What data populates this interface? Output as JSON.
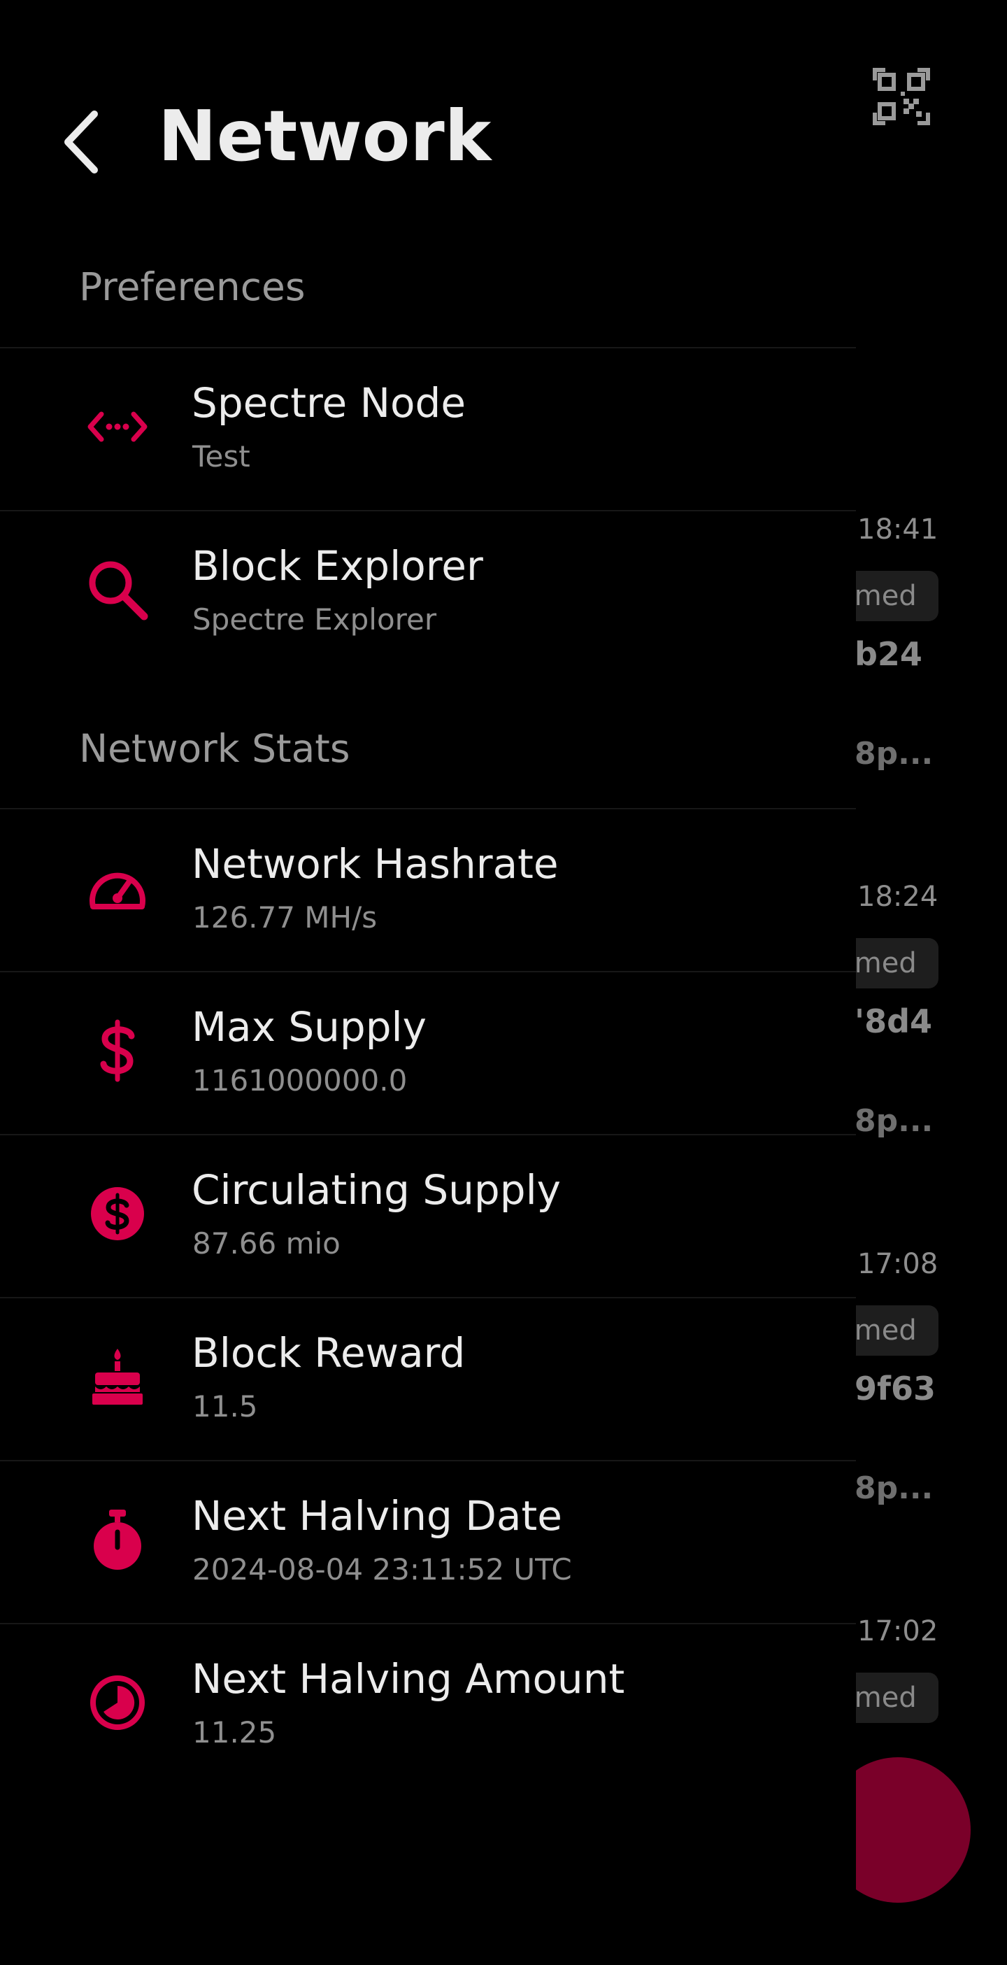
{
  "header": {
    "title": "Network",
    "back_icon": "chevron-left-icon",
    "qr_icon": "qr-code-icon"
  },
  "sections": [
    {
      "title": "Preferences",
      "items": [
        {
          "title": "Spectre Node",
          "subtitle": "Test",
          "icon": "code-arrows-icon"
        },
        {
          "title": "Block Explorer",
          "subtitle": "Spectre Explorer",
          "icon": "search-icon"
        }
      ]
    },
    {
      "title": "Network Stats",
      "items": [
        {
          "title": "Network Hashrate",
          "subtitle": "126.77 MH/s",
          "icon": "gauge-icon"
        },
        {
          "title": "Max Supply",
          "subtitle": "1161000000.0",
          "icon": "dollar-icon"
        },
        {
          "title": "Circulating Supply",
          "subtitle": "87.66 mio",
          "icon": "dollar-circle-icon"
        },
        {
          "title": "Block Reward",
          "subtitle": "11.5",
          "icon": "cake-icon"
        },
        {
          "title": "Next Halving Date",
          "subtitle": "2024-08-04 23:11:52 UTC",
          "icon": "stopwatch-icon"
        },
        {
          "title": "Next Halving Amount",
          "subtitle": "11.25",
          "icon": "pie-timer-icon"
        }
      ]
    }
  ],
  "background_transactions": [
    {
      "time": "18:41",
      "status": "rmed",
      "hash": "b24",
      "address": "8p..."
    },
    {
      "time": "18:24",
      "status": "rmed",
      "hash": "'8d4",
      "address": "8p..."
    },
    {
      "time": "17:08",
      "status": "rmed",
      "hash": "9f63",
      "address": "8p..."
    },
    {
      "time": "17:02",
      "status": "rmed"
    }
  ],
  "colors": {
    "accent": "#d9004c",
    "background": "#000000",
    "fab": "#7a0029"
  }
}
